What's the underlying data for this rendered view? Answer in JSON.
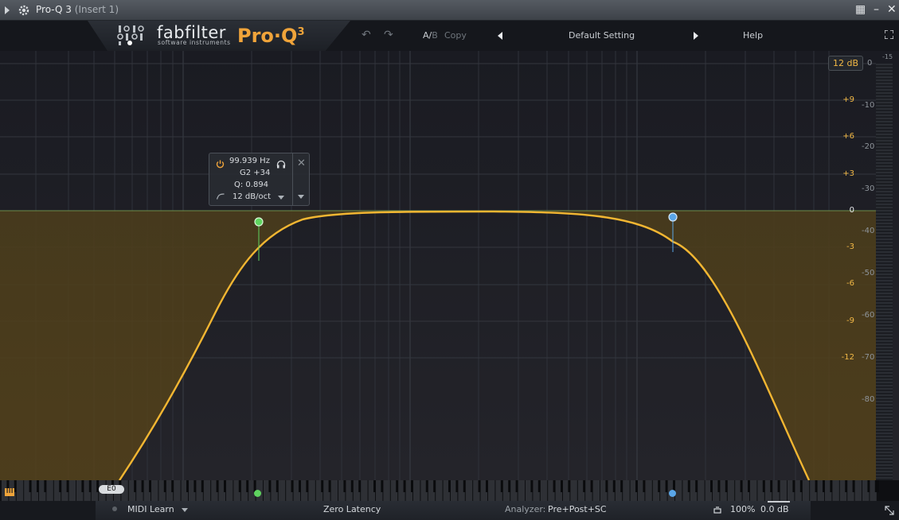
{
  "host": {
    "title": "Pro-Q 3",
    "instance": "(Insert 1)",
    "controls": [
      "▦",
      "–",
      "✕"
    ]
  },
  "header": {
    "brand": "fabfilter",
    "brand_sub": "software instruments",
    "product": "Pro·Q",
    "product_version": "3",
    "ab_label": "A/",
    "ab_b_label": "B",
    "copy_label": "Copy",
    "preset": "Default Setting",
    "help_label": "Help"
  },
  "graph": {
    "range_button": "12 dB",
    "db_scale": [
      "+9",
      "+6",
      "+3",
      "0",
      "-3",
      "-6",
      "-9",
      "-12"
    ],
    "analyzer_scale": [
      "0",
      "-10",
      "-20",
      "-30",
      "-40",
      "-50",
      "-60",
      "-70",
      "-80"
    ],
    "meter_top_label": "-15"
  },
  "band_panel": {
    "frequency": "99.939 Hz",
    "note": "G2 +34",
    "q": "Q: 0.894",
    "slope": "12 dB/oct"
  },
  "piano": {
    "note_tag": "E0"
  },
  "footer": {
    "midi_learn": "MIDI Learn",
    "latency": "Zero Latency",
    "analyzer_label": "Analyzer:",
    "analyzer_value": "Pre+Post+SC",
    "zoom": "100%",
    "output_gain": "0.0 dB"
  },
  "colors": {
    "curve": "#f2b632",
    "band_low": "#5fd45f",
    "band_high": "#5aa6e8",
    "accent": "#f0a43a"
  }
}
